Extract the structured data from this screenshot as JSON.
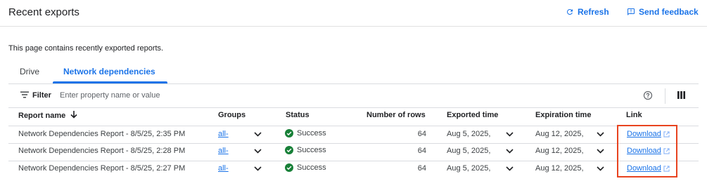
{
  "header": {
    "title": "Recent exports",
    "refresh_label": "Refresh",
    "feedback_label": "Send feedback"
  },
  "description": "This page contains recently exported reports.",
  "tabs": [
    {
      "label": "Drive",
      "active": false
    },
    {
      "label": "Network dependencies",
      "active": true
    }
  ],
  "filter": {
    "label": "Filter",
    "placeholder": "Enter property name or value"
  },
  "table": {
    "columns": {
      "report_name": "Report name",
      "groups": "Groups",
      "status": "Status",
      "rows": "Number of rows",
      "exported": "Exported time",
      "expiration": "Expiration time",
      "link": "Link"
    },
    "sort": {
      "column": "Report name",
      "direction": "descending"
    },
    "rows": [
      {
        "name": "Network Dependencies Report - 8/5/25, 2:35 PM",
        "groups": "all-",
        "status": "Success",
        "rows": "64",
        "exported": "Aug 5, 2025,",
        "expiration": "Aug 12, 2025,",
        "link": "Download"
      },
      {
        "name": "Network Dependencies Report - 8/5/25, 2:28 PM",
        "groups": "all-",
        "status": "Success",
        "rows": "64",
        "exported": "Aug 5, 2025,",
        "expiration": "Aug 12, 2025,",
        "link": "Download"
      },
      {
        "name": "Network Dependencies Report - 8/5/25, 2:27 PM",
        "groups": "all-",
        "status": "Success",
        "rows": "64",
        "exported": "Aug 5, 2025,",
        "expiration": "Aug 12, 2025,",
        "link": "Download"
      }
    ]
  },
  "colors": {
    "accent": "#1a73e8",
    "success": "#188038",
    "highlight": "#e8431f"
  },
  "icons": {
    "refresh": "refresh-icon",
    "feedback": "feedback-icon",
    "filter": "filter-icon",
    "help": "help-icon",
    "columns": "column-picker-icon",
    "sort": "sort-arrow-down-icon",
    "status": "check-circle-icon",
    "expand": "chevron-down-icon",
    "external": "external-link-icon"
  }
}
